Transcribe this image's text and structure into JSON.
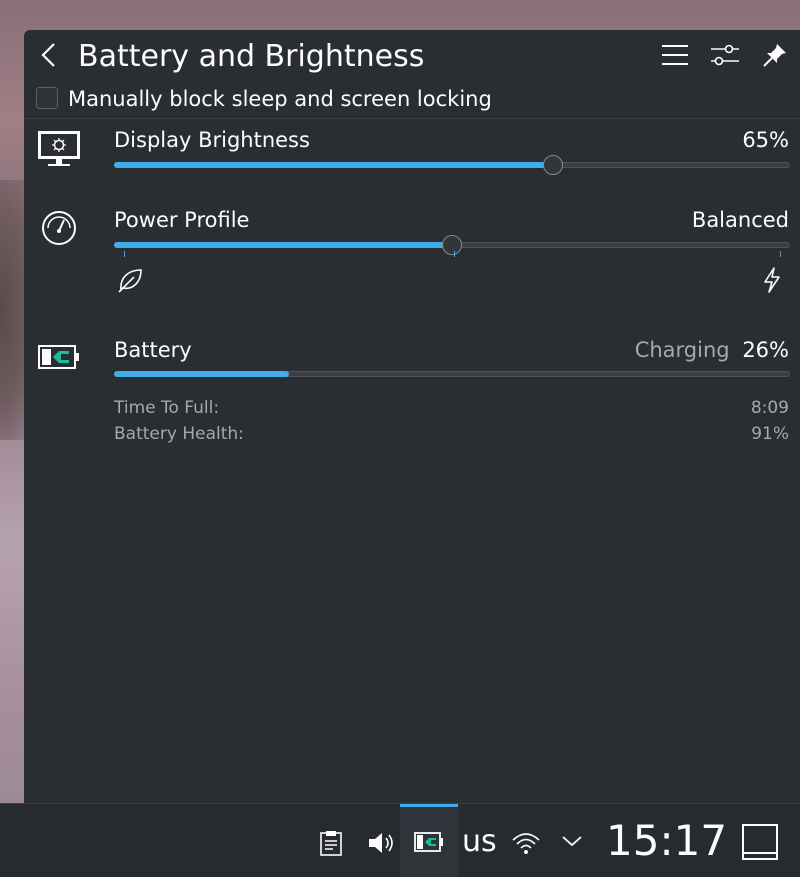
{
  "header": {
    "title": "Battery and Brightness",
    "back_icon": "chevron-left-icon",
    "menu_icon": "hamburger-menu-icon",
    "configure_icon": "sliders-icon",
    "pin_icon": "pin-icon"
  },
  "inhibit": {
    "label": "Manually block sleep and screen locking",
    "checked": false
  },
  "brightness": {
    "label": "Display Brightness",
    "value_text": "65%",
    "level": 0.65,
    "icon": "monitor-brightness-icon"
  },
  "power_profile": {
    "label": "Power Profile",
    "value_text": "Balanced",
    "level": 0.5,
    "icon": "speedometer-icon",
    "left_icon": "leaf-icon",
    "right_icon": "lightning-icon"
  },
  "battery": {
    "label": "Battery",
    "status": "Charging",
    "value_text": "26%",
    "level": 0.26,
    "icon": "battery-charging-icon",
    "details": [
      {
        "label": "Time To Full:",
        "value": "8:09"
      },
      {
        "label": "Battery Health:",
        "value": "91%"
      }
    ]
  },
  "taskbar": {
    "keyboard_layout": "us",
    "clock": "15:17",
    "icons": [
      "clipboard-icon",
      "volume-icon",
      "battery-icon",
      "wifi-icon",
      "chevron-down-icon",
      "show-desktop-icon"
    ]
  },
  "colors": {
    "accent": "#3daee9",
    "panel_bg": "#2a2e32",
    "battery_green": "#1abc9c"
  }
}
